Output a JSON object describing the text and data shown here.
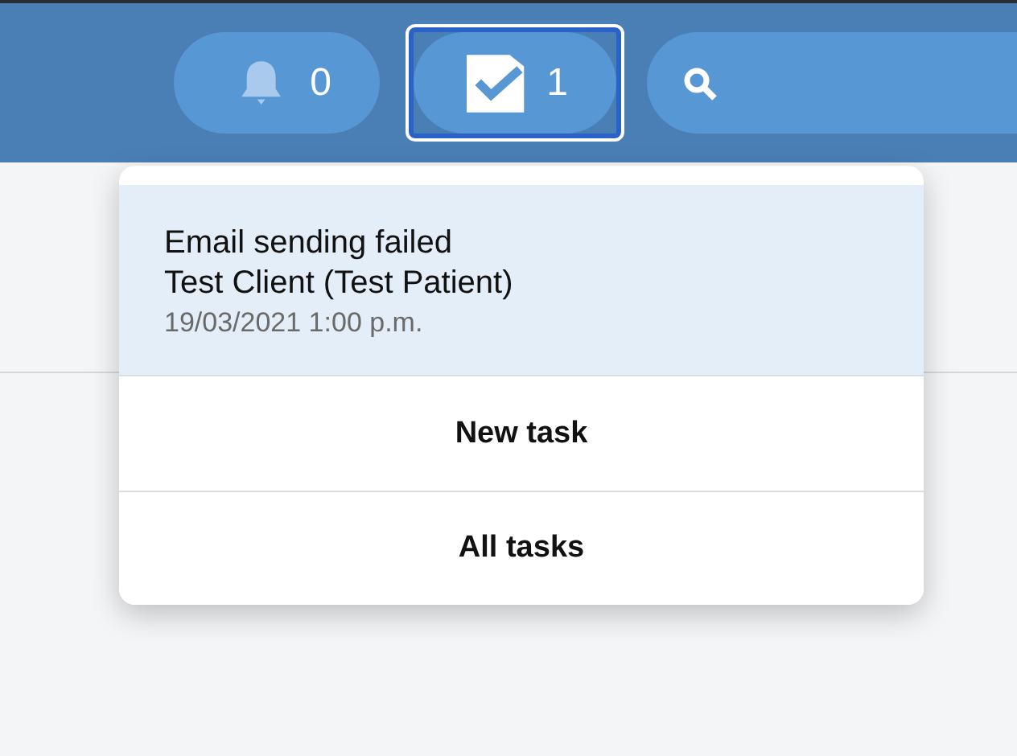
{
  "header": {
    "notifications": {
      "count": "0"
    },
    "tasks": {
      "count": "1",
      "focused": true
    }
  },
  "task_menu": {
    "tasks": [
      {
        "title": "Email sending failed",
        "subject": "Test Client (Test Patient)",
        "time": "19/03/2021 1:00 p.m.",
        "unread": true
      }
    ],
    "actions": [
      "New task",
      "All tasks"
    ]
  }
}
